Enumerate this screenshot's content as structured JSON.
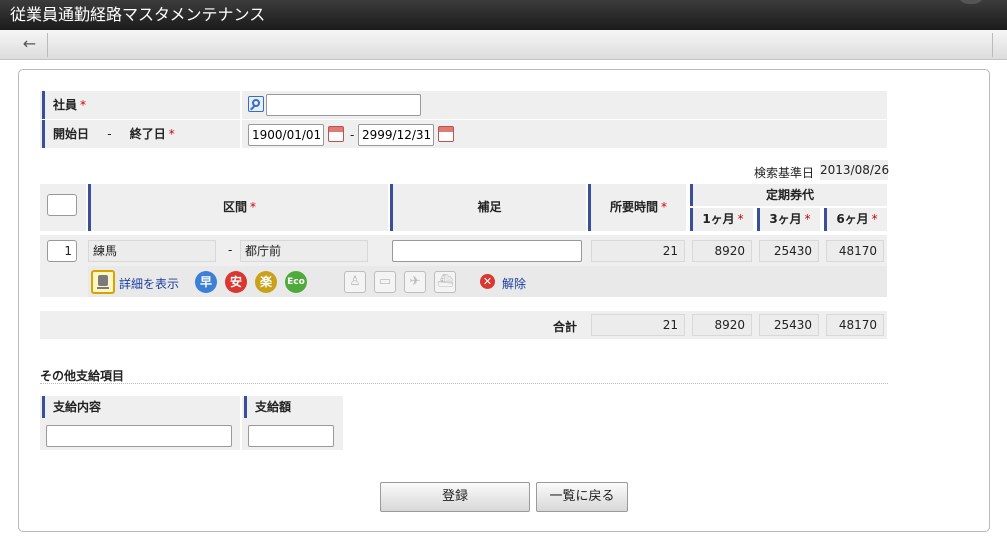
{
  "window": {
    "title": "従業員通勤経路マスタメンテナンス"
  },
  "toolbar": {
    "back_icon": "←"
  },
  "form": {
    "employee": {
      "label": "社員",
      "required": "*",
      "value": ""
    },
    "period": {
      "label_start": "開始日",
      "separator": "-",
      "label_end": "終了日",
      "required": "*",
      "start_value": "1900/01/01",
      "end_value": "2999/12/31"
    },
    "search_date": {
      "label": "検索基準日",
      "value": "2013/08/26"
    }
  },
  "route_table": {
    "headers": {
      "section": "区間",
      "supplement": "補足",
      "time": "所要時間",
      "pass": "定期券代",
      "m1": "1ヶ月",
      "m3": "3ヶ月",
      "m6": "6ヶ月",
      "required": "*"
    },
    "row": {
      "number": "1",
      "from": "練馬",
      "separator": "-",
      "to": "都庁前",
      "supplement": "",
      "time": "21",
      "m1": "8920",
      "m3": "25430",
      "m6": "48170"
    },
    "actions": {
      "detail_label": "詳細を表示",
      "badges": [
        "早",
        "安",
        "楽",
        "Eco"
      ],
      "remove_label": "解除"
    },
    "total": {
      "label": "合計",
      "time": "21",
      "m1": "8920",
      "m3": "25430",
      "m6": "48170"
    }
  },
  "other": {
    "section_title": "その他支給項目",
    "col_content": "支給内容",
    "col_amount": "支給額",
    "content_value": "",
    "amount_value": ""
  },
  "buttons": {
    "register": "登録",
    "back_to_list": "一覧に戻る"
  },
  "colors": {
    "accent": "#3a4f9a",
    "required": "#d40000",
    "early": "#3b7fd6",
    "safe": "#d9372f",
    "easy": "#c9a21a",
    "eco": "#4eaa3a"
  }
}
